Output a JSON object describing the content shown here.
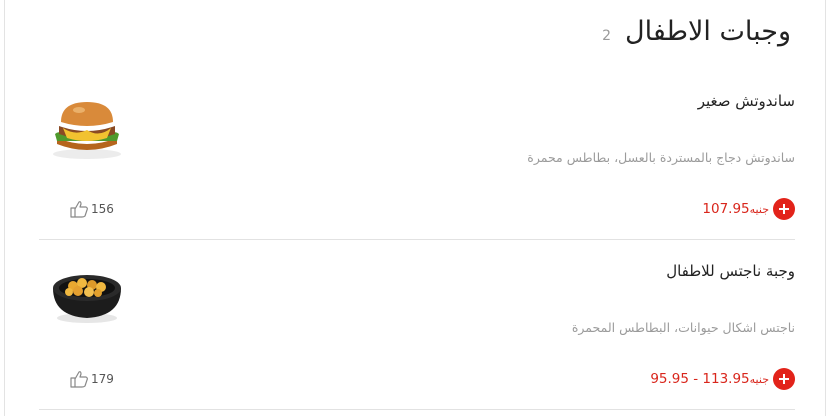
{
  "section": {
    "title": "وجبات الاطفال",
    "count": "2"
  },
  "items": [
    {
      "name": "ساندوتش صغير",
      "description": "ساندوتش دجاج بالمستردة بالعسل، بطاطس محمرة",
      "price": "107.95",
      "currency": "جنيه",
      "likes": "156",
      "image_icon": "burger-icon"
    },
    {
      "name": "وجبة ناجتس للاطفال",
      "description": "ناجتس اشكال حيوانات، البطاطس المحمرة",
      "price": "95.95 - 113.95",
      "currency": "جنيه",
      "likes": "179",
      "image_icon": "nuggets-bowl-icon"
    }
  ],
  "colors": {
    "accent": "#e2231a",
    "price": "#d9261c",
    "muted": "#9b9b9b"
  }
}
